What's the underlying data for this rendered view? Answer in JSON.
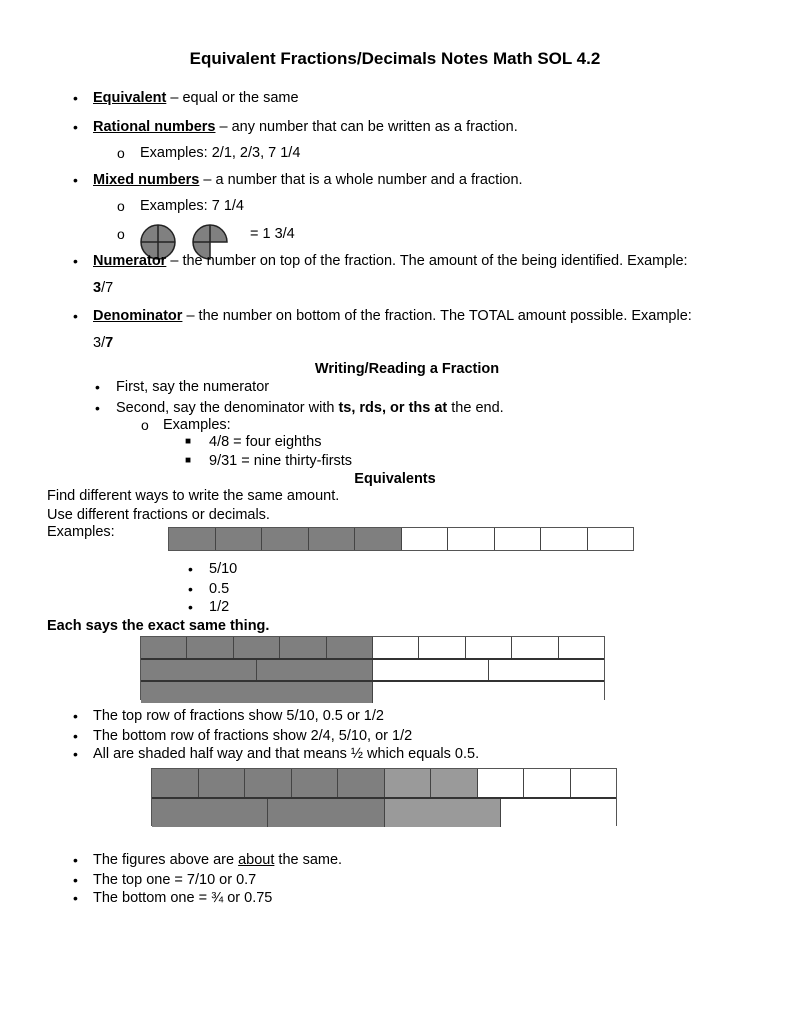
{
  "title": "Equivalent Fractions/Decimals Notes Math SOL 4.2",
  "defs": [
    {
      "term": "Equivalent",
      "text": " – equal or the same"
    },
    {
      "term": "Rational numbers",
      "text": " – any number that can be written as a fraction."
    },
    {
      "sub": "Examples: 2/1, 2/3,  7  1/4"
    },
    {
      "term": "Mixed numbers",
      "text": " – a number that is a whole number and a fraction."
    },
    {
      "sub": "Examples: 7  1/4"
    },
    {
      "sub": "=    1   3/4"
    },
    {
      "term": "Numerator",
      "text": " – the number on top of the fraction. The amount of the being identified. Example:",
      "ex_bold": "3",
      "ex_rest": "/7"
    },
    {
      "term": "Denominator",
      "text": " – the number on bottom of the fraction. The TOTAL amount possible. Example:",
      "ex_rest": "3/",
      "ex_bold": "7"
    }
  ],
  "writing": {
    "heading": "Writing/Reading a Fraction",
    "b1": "First, say the numerator",
    "b2_pre": "Second, say the denominator with ",
    "b2_bold": "ts, rds, or ths at",
    "b2_post": " the end.",
    "examples": "Examples:",
    "ex1": "4/8 = four eighths",
    "ex2": "9/31 = nine thirty-firsts"
  },
  "equiv": {
    "heading": "Equivalents",
    "l1": "Find different ways to write the same amount.",
    "l2": "Use different fractions or decimals.",
    "l3": "Examples:",
    "items": [
      "5/10",
      "0.5",
      "1/2"
    ],
    "same": "Each says the exact same thing.",
    "notes1": [
      "The top row of fractions show 5/10, 0.5 or 1/2",
      "The bottom row of fractions show 2/4, 5/10, or 1/2",
      "All are shaded half way and that means ½ which equals 0.5."
    ],
    "notes2_pre": "The figures above are ",
    "notes2_u": "about",
    "notes2_post": " the same.",
    "notes3": [
      "The top one = 7/10 or 0.7",
      "The bottom one = ¾ or 0.75"
    ]
  },
  "bars": {
    "bar1": {
      "parts": 10,
      "shaded": 5
    },
    "bar2": [
      {
        "parts": 10,
        "shaded": 5
      },
      {
        "parts": 4,
        "shaded": 2
      },
      {
        "parts": 2,
        "shaded": 1
      }
    ],
    "bar3": [
      {
        "parts": 10,
        "shaded": 7
      },
      {
        "parts": 4,
        "shaded": 3
      }
    ],
    "colors": {
      "shaded": "#7f7f7f",
      "light": "#9a9a9a"
    }
  }
}
